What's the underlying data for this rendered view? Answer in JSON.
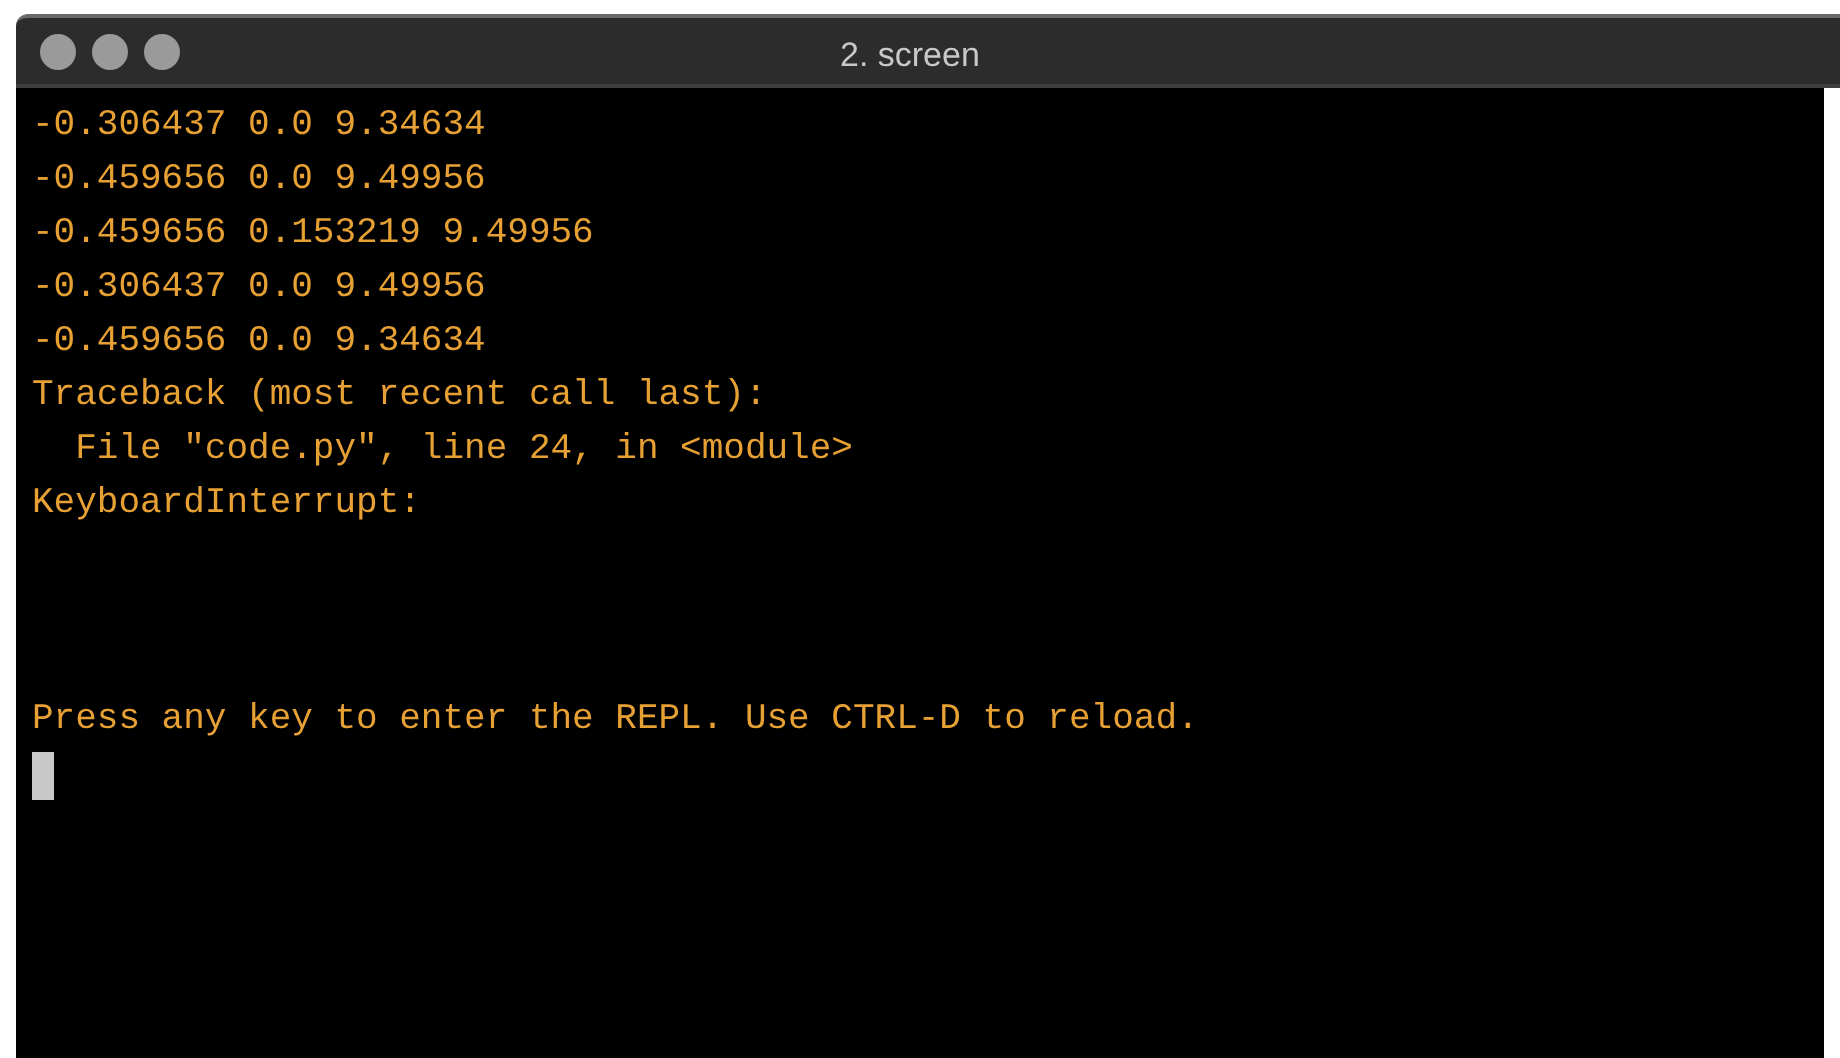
{
  "window": {
    "title": "2. screen"
  },
  "terminal": {
    "output": [
      "-0.306437 0.0 9.34634",
      "-0.459656 0.0 9.49956",
      "-0.459656 0.153219 9.49956",
      "-0.306437 0.0 9.49956",
      "-0.459656 0.0 9.34634",
      "Traceback (most recent call last):",
      "  File \"code.py\", line 24, in <module>",
      "KeyboardInterrupt:"
    ],
    "prompt": "Press any key to enter the REPL. Use CTRL-D to reload."
  }
}
